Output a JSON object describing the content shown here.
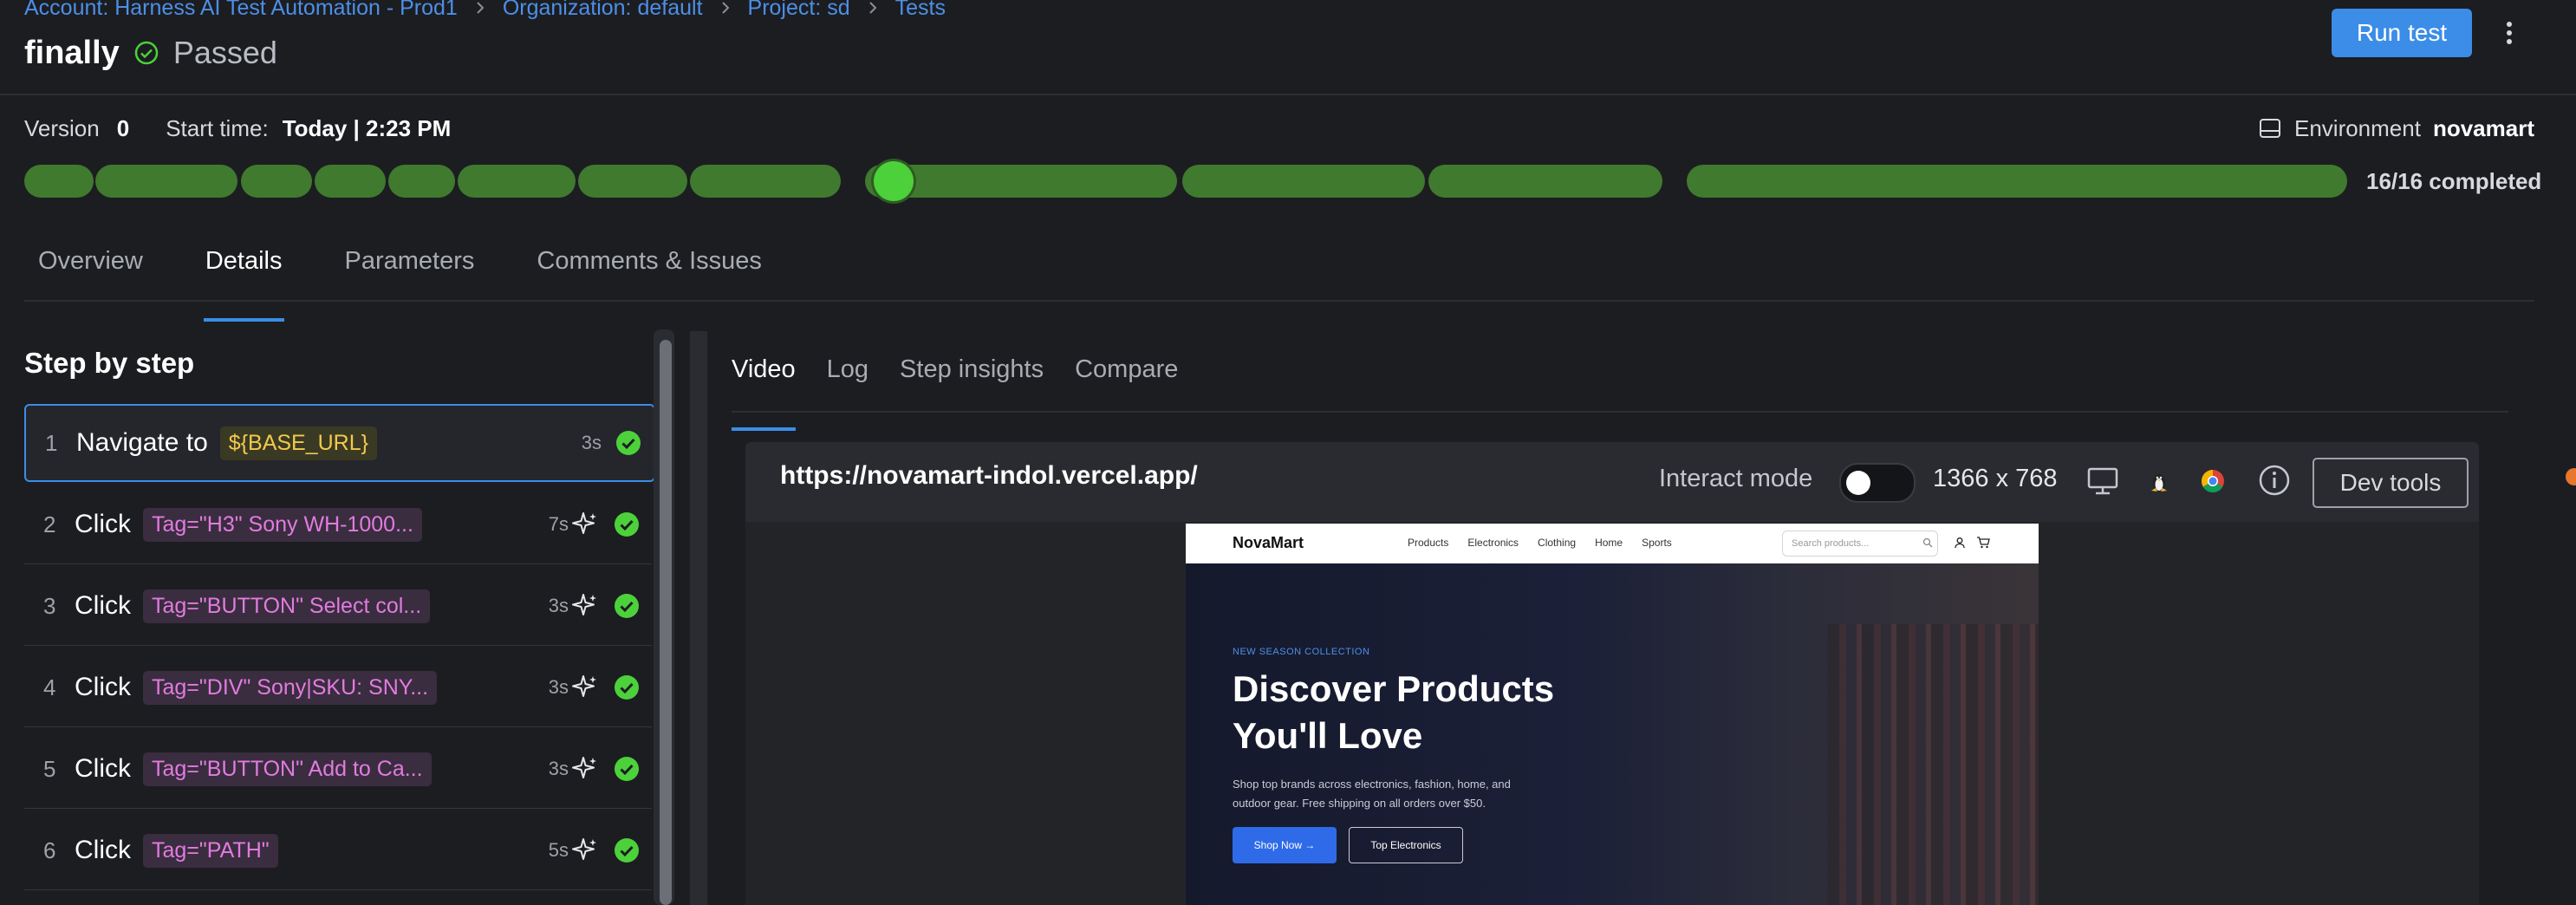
{
  "breadcrumb": {
    "account": "Account: Harness AI Test Automation - Prod1",
    "organization": "Organization: default",
    "project": "Project: sd",
    "tests": "Tests"
  },
  "header": {
    "title": "finally",
    "status": "Passed",
    "run_button": "Run test"
  },
  "meta": {
    "version_label": "Version",
    "version_value": "0",
    "start_label": "Start time:",
    "start_value": "Today | 2:23 PM",
    "environment_label": "Environment",
    "environment_value": "novamart"
  },
  "progress": {
    "completed_text": "16/16 completed",
    "completed": 16,
    "total": 16,
    "current_position": 0.37
  },
  "tabs": [
    "Overview",
    "Details",
    "Parameters",
    "Comments & Issues"
  ],
  "active_tab": "Details",
  "steps_panel": {
    "title": "Step by step",
    "steps": [
      {
        "num": "1",
        "action": "Navigate to",
        "target": "${BASE_URL}",
        "time": "3s",
        "ai": false
      },
      {
        "num": "2",
        "action": "Click",
        "target": "Tag=\"H3\" Sony WH-1000...",
        "time": "7s",
        "ai": true
      },
      {
        "num": "3",
        "action": "Click",
        "target": "Tag=\"BUTTON\" Select col...",
        "time": "3s",
        "ai": true
      },
      {
        "num": "4",
        "action": "Click",
        "target": "Tag=\"DIV\" Sony|SKU: SNY...",
        "time": "3s",
        "ai": true
      },
      {
        "num": "5",
        "action": "Click",
        "target": "Tag=\"BUTTON\" Add to Ca...",
        "time": "3s",
        "ai": true
      },
      {
        "num": "6",
        "action": "Click",
        "target": "Tag=\"PATH\"",
        "time": "5s",
        "ai": true
      }
    ]
  },
  "right_tabs": [
    "Video",
    "Log",
    "Step insights",
    "Compare"
  ],
  "active_right_tab": "Video",
  "browser": {
    "url": "https://novamart-indol.vercel.app/",
    "interact_label": "Interact mode",
    "interact_on": false,
    "resolution": "1366 x 768",
    "dev_tools": "Dev tools",
    "icons": [
      "monitor-icon",
      "linux-icon",
      "chrome-icon",
      "info-icon"
    ]
  },
  "site": {
    "logo": "NovaMart",
    "nav": [
      "Products",
      "Electronics",
      "Clothing",
      "Home",
      "Sports"
    ],
    "search_placeholder": "Search products...",
    "kicker": "NEW SEASON COLLECTION",
    "title_line1": "Discover Products",
    "title_line2": "You'll Love",
    "subtitle_line1": "Shop top brands across electronics, fashion, home, and",
    "subtitle_line2": "outdoor gear. Free shipping on all orders over $50.",
    "btn_primary": "Shop Now →",
    "btn_secondary": "Top Electronics"
  },
  "colors": {
    "accent": "#3b8de8",
    "success": "#4cd13a",
    "progress": "#3f7a2e",
    "background": "#1c1d21"
  }
}
